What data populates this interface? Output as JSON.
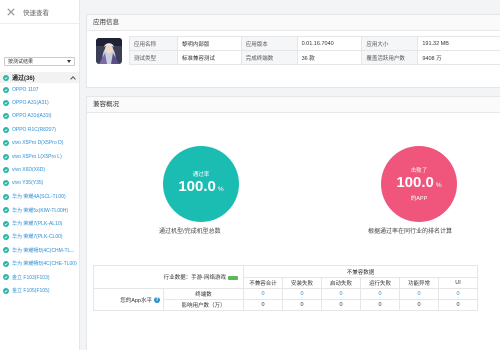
{
  "sidebar": {
    "quick_select_label": "快速查看",
    "filter_select": "按测试结果",
    "pass_group_label": "通过(36)",
    "devices": [
      "OPPO 1107",
      "OPPO A31(A31)",
      "OPPO A31t(A31t)",
      "OPPO R1C(R8207)",
      "vivo X5Pro D(X5Pro D)",
      "vivo X5Pro L(X5Pro L)",
      "vivo X6D(X6D)",
      "vivo Y35(Y35)",
      "华为 荣耀4A(SCL-TL00)",
      "华为 荣耀5x(KIW-TL00H)",
      "华为 荣耀7(PLK-AL10)",
      "华为 荣耀7(PLK-CL00)",
      "华为 荣耀畅玩4C(CHM-TL...",
      "华为 荣耀畅玩4C(CHE-TL00)",
      "金立 F103(F103)",
      "金立 F105(F105)"
    ]
  },
  "app_info": {
    "title": "应用信息",
    "rows": [
      [
        {
          "label": "应用名称",
          "value": "黎明内部版"
        },
        {
          "label": "应用版本",
          "value": "0.01.16.7040"
        },
        {
          "label": "应用大小",
          "value": "191.32 MB"
        }
      ],
      [
        {
          "label": "测试类型",
          "value": "标准兼容测试"
        },
        {
          "label": "完成终端数",
          "value": "36 款"
        },
        {
          "label": "覆盖活跃用户数",
          "value": "9408 万"
        }
      ]
    ]
  },
  "compat": {
    "title": "兼容概况",
    "gauge_pass": {
      "top": "通过率",
      "value": "100.0",
      "unit": "%",
      "bottom": "",
      "caption": "通过机型/完成机型总数"
    },
    "gauge_rank": {
      "top": "击败了",
      "value": "100.0",
      "unit": "%",
      "bottom": "的APP",
      "caption": "根据通过率在同行业的排名计算"
    }
  },
  "compat_table": {
    "industry_label": "行业数据：手游-网络游戏",
    "incompat_group_label": "不兼容数据",
    "columns": [
      "不兼容合计",
      "安装失败",
      "启动失败",
      "运行失败",
      "功能异常",
      "UI"
    ],
    "your_app_label": "您的App水平",
    "row_terminals_label": "终端数",
    "row_users_label": "影响用户数（万）",
    "row_terminals": [
      "0",
      "0",
      "0",
      "0",
      "0",
      "0"
    ],
    "row_users": [
      "0",
      "0",
      "0",
      "0",
      "0",
      "0"
    ]
  },
  "colors": {
    "accent_teal": "#1bbdb2",
    "accent_pink": "#f0567c",
    "link_blue": "#2b8fd6",
    "check_green": "#2bb6a8"
  },
  "icons": {
    "collapse": "x-icon",
    "check": "check-circle-icon",
    "help": "help-icon"
  }
}
